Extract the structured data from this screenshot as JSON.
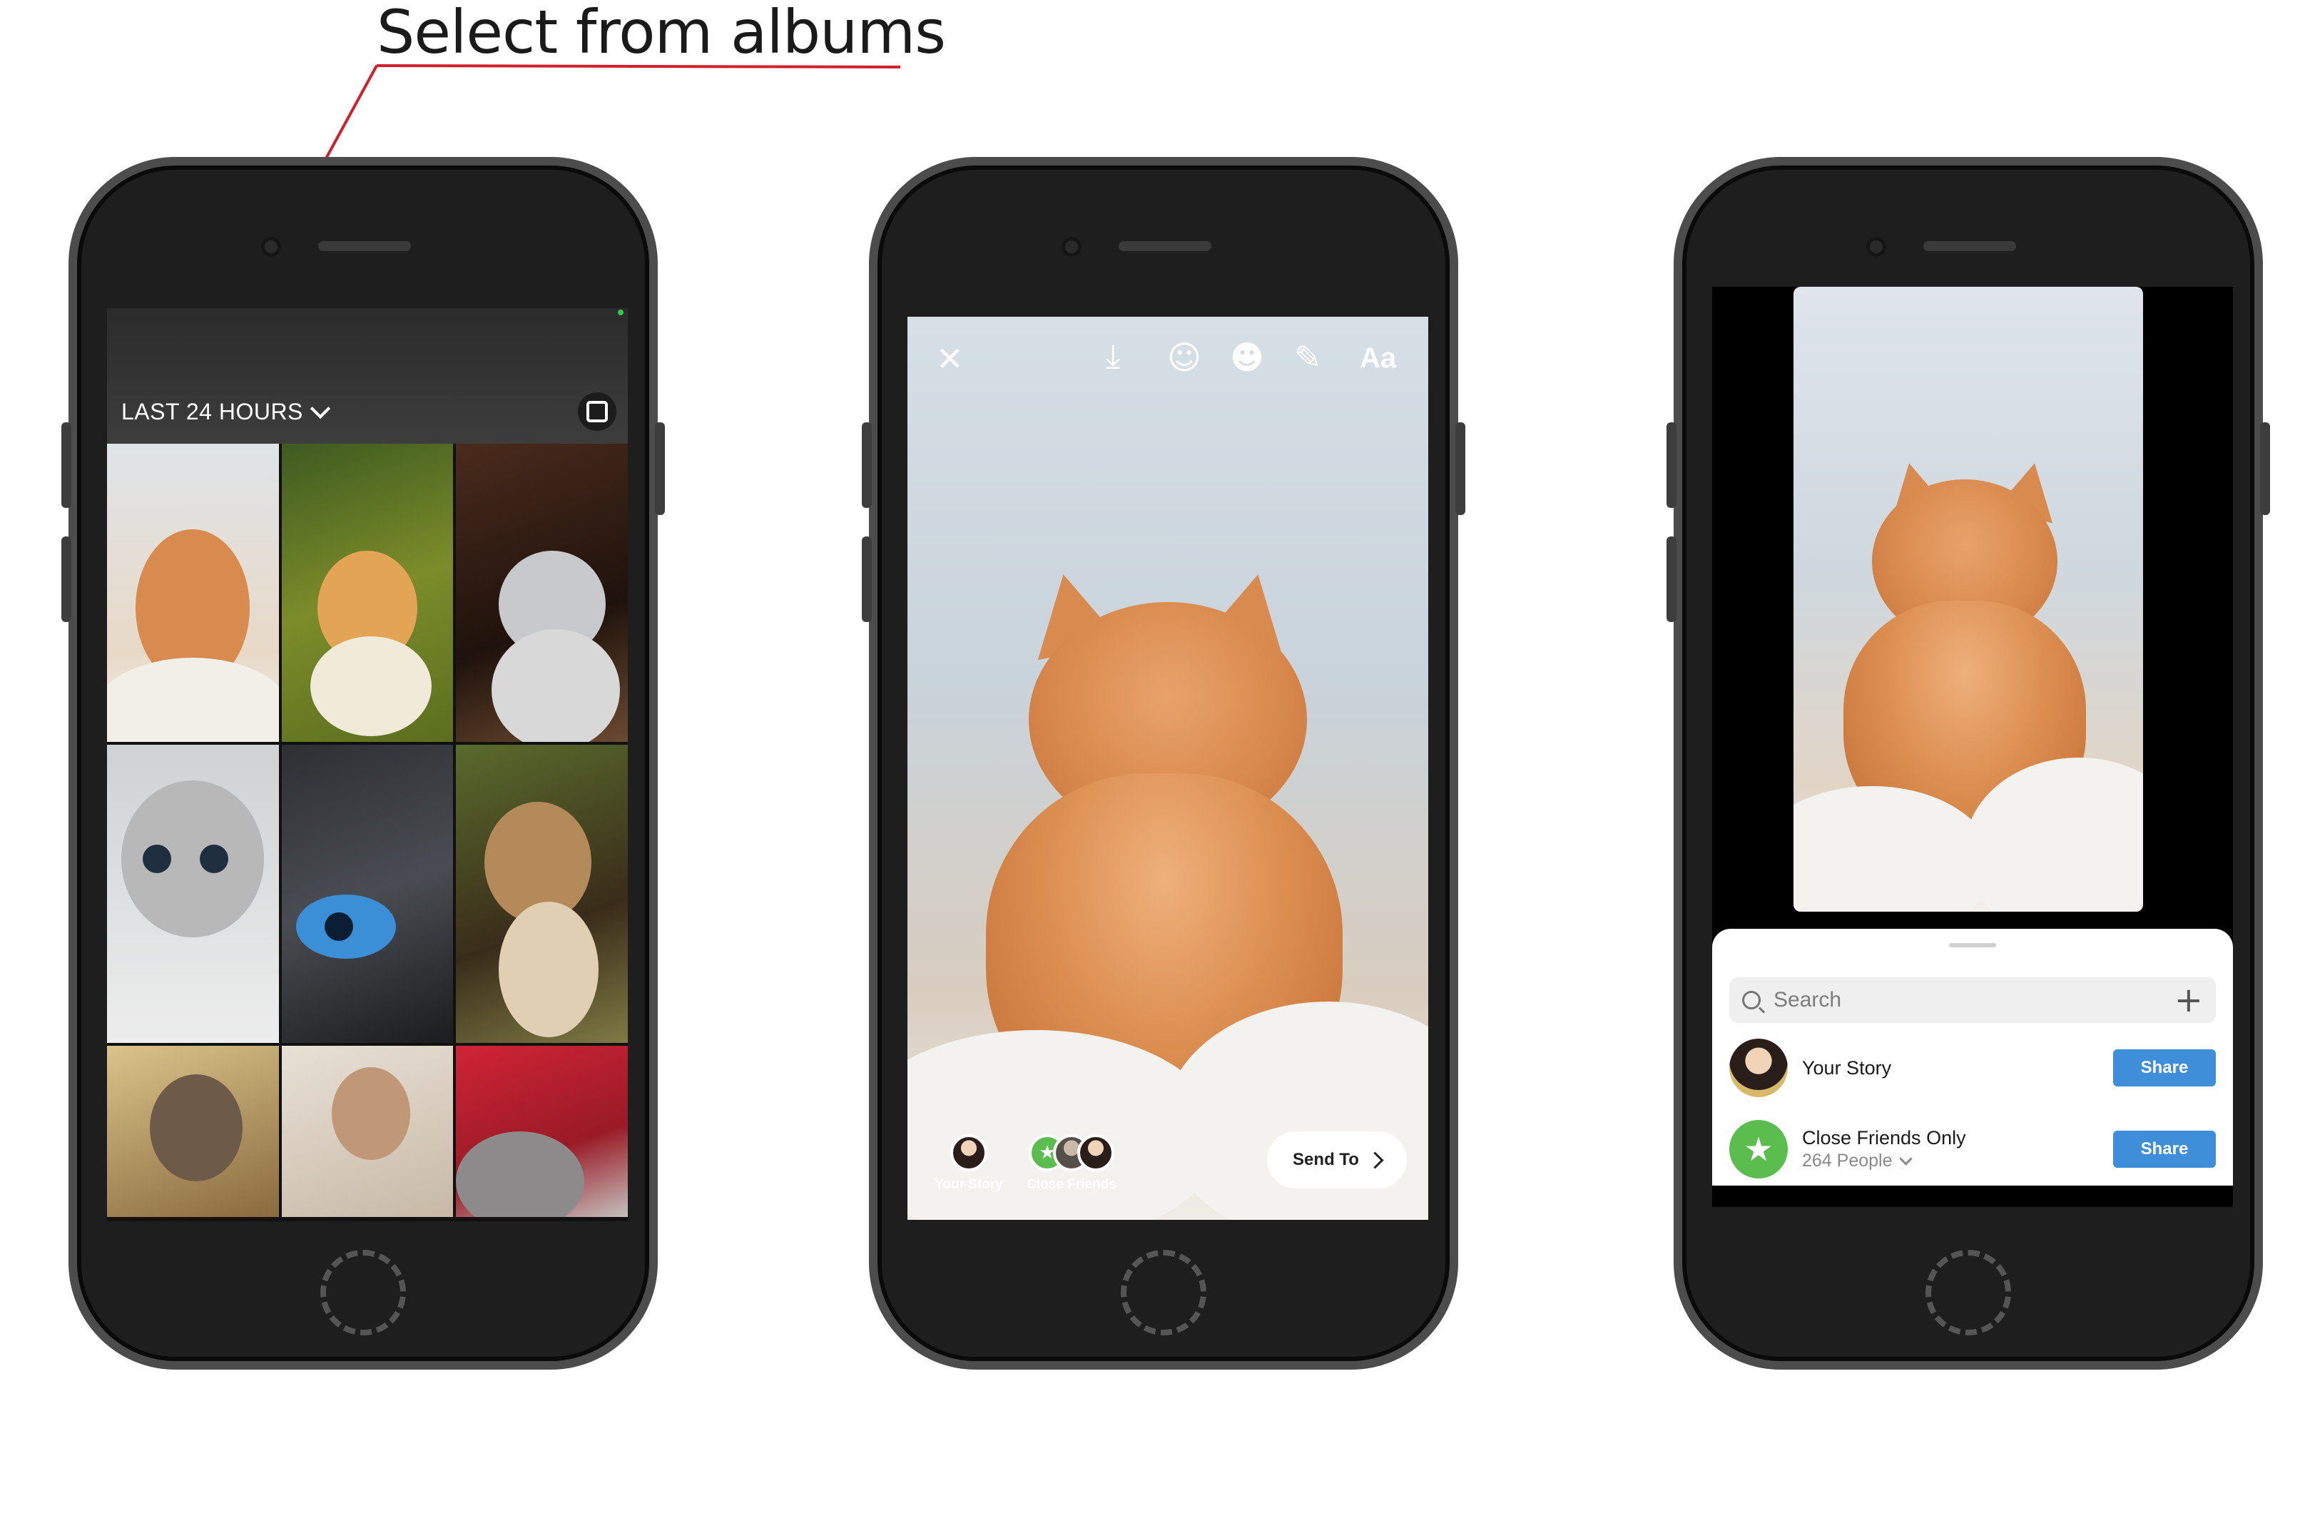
{
  "callout": {
    "title": "Select from albums",
    "color": "#d21f2b"
  },
  "phone_gallery": {
    "album_label": "LAST 24 HOURS",
    "album_icon": "chevron-down-icon",
    "multi_select_icon": "multi-select-icon"
  },
  "phone_editor": {
    "toolbar": {
      "close_icon": "close-icon",
      "download_icon": "download-icon",
      "face_filter_icon": "face-filter-icon",
      "sticker_icon": "sticker-icon",
      "draw_icon": "draw-icon",
      "text_label": "Aa"
    },
    "targets": [
      {
        "label": "Your Story"
      },
      {
        "label": "Close Friends"
      }
    ],
    "send_to_label": "Send To"
  },
  "phone_share": {
    "search_placeholder": "Search",
    "rows": [
      {
        "name": "Your Story",
        "sub": "",
        "button": "Share"
      },
      {
        "name": "Close Friends Only",
        "sub": "264 People",
        "button": "Share"
      }
    ],
    "share_button_color": "#3e8ed9",
    "close_friends_color": "#5bbd4d"
  }
}
